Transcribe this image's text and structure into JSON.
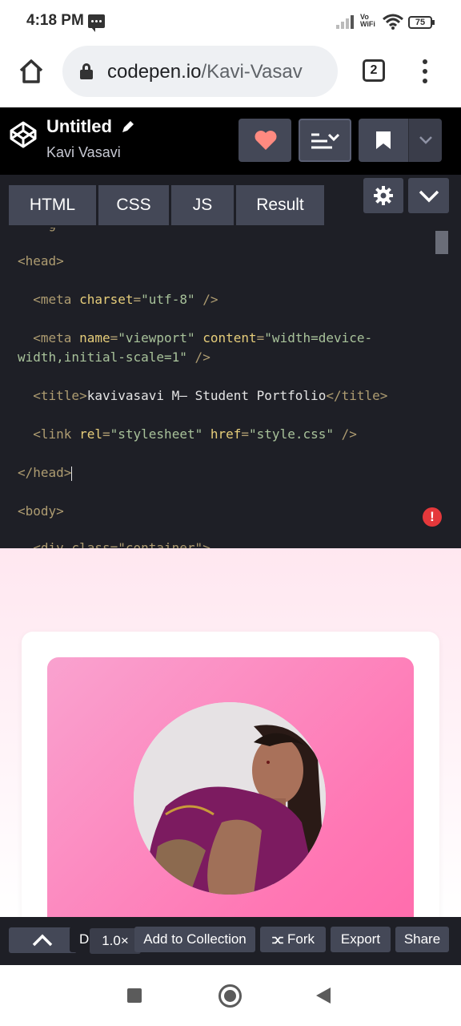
{
  "status_bar": {
    "time": "4:18 PM",
    "network_label_top": "Vo",
    "network_label_bottom": "WiFi",
    "battery": "75"
  },
  "browser": {
    "url_host": "codepen.io",
    "url_path": "/Kavi-Vasav",
    "tab_count": "2"
  },
  "pen": {
    "title": "Untitled",
    "author": "Kavi Vasavi"
  },
  "editor": {
    "tabs": [
      {
        "label": "HTML"
      },
      {
        "label": "CSS"
      },
      {
        "label": "JS"
      },
      {
        "label": "Result"
      }
    ],
    "code": {
      "head_open": "<head>",
      "meta_tag": "<meta",
      "charset_attr": "charset",
      "charset_val": "\"utf-8\"",
      "self_close": " />",
      "name_attr": "name",
      "name_val": "\"viewport\"",
      "content_attr": "content",
      "content_val_1": "\"width=device-",
      "content_val_2": "width,initial-scale=1\"",
      "title_open": "<title>",
      "title_text": "kavivasavi M— Student Portfolio",
      "title_close": "</title>",
      "link_tag": "<link",
      "rel_attr": "rel",
      "rel_val": "\"stylesheet\"",
      "href_attr": "href",
      "href_val": "\"style.css\"",
      "head_close": "</head>",
      "body_open": "<body>"
    },
    "error_symbol": "!"
  },
  "toolbar": {
    "d_label": "D",
    "zoom": "1.0×",
    "add_to_collection": "Add to Collection",
    "fork": "Fork",
    "export": "Export",
    "share": "Share"
  },
  "colors": {
    "editor_bg": "#1e1f26",
    "button_bg": "#444857",
    "heart": "#ff8a80",
    "banner_pink": "#ff77b4"
  }
}
